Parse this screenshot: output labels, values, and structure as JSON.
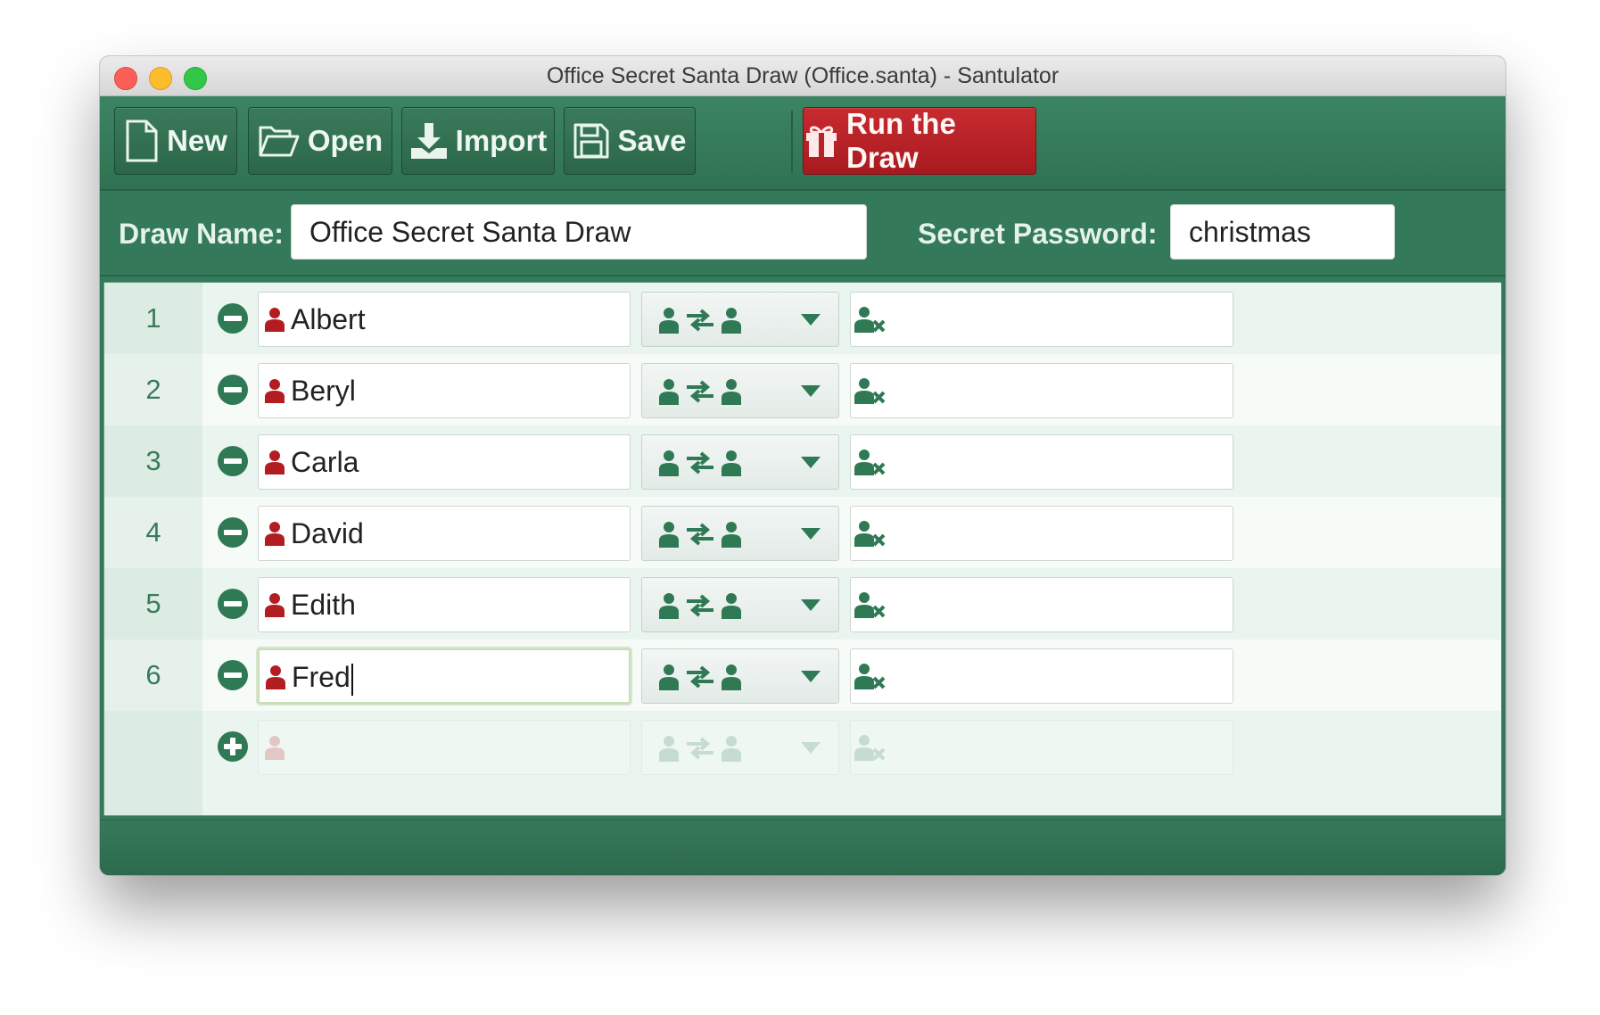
{
  "window": {
    "title": "Office Secret Santa Draw (Office.santa) - Santulator"
  },
  "toolbar": {
    "new_label": "New",
    "open_label": "Open",
    "import_label": "Import",
    "save_label": "Save",
    "run_label": "Run the Draw"
  },
  "fields": {
    "draw_name_label": "Draw Name:",
    "draw_name_value": "Office Secret Santa Draw",
    "password_label": "Secret Password:",
    "password_value": "christmas"
  },
  "participants": [
    {
      "number": "1",
      "name": "Albert",
      "relationship_icon": "person-exchange-person-icon",
      "exclusion_icon": "person-excluded-icon"
    },
    {
      "number": "2",
      "name": "Beryl",
      "relationship_icon": "person-exchange-person-icon",
      "exclusion_icon": "person-excluded-icon"
    },
    {
      "number": "3",
      "name": "Carla",
      "relationship_icon": "person-exchange-person-icon",
      "exclusion_icon": "person-excluded-icon"
    },
    {
      "number": "4",
      "name": "David",
      "relationship_icon": "person-exchange-person-icon",
      "exclusion_icon": "person-excluded-icon"
    },
    {
      "number": "5",
      "name": "Edith",
      "relationship_icon": "person-exchange-person-icon",
      "exclusion_icon": "person-excluded-icon"
    },
    {
      "number": "6",
      "name": "Fred",
      "relationship_icon": "person-exchange-person-icon",
      "exclusion_icon": "person-excluded-icon"
    }
  ],
  "colors": {
    "accent_green": "#34795a",
    "run_red": "#b82126",
    "person_red": "#b31d22",
    "icon_green": "#2f7a55"
  }
}
